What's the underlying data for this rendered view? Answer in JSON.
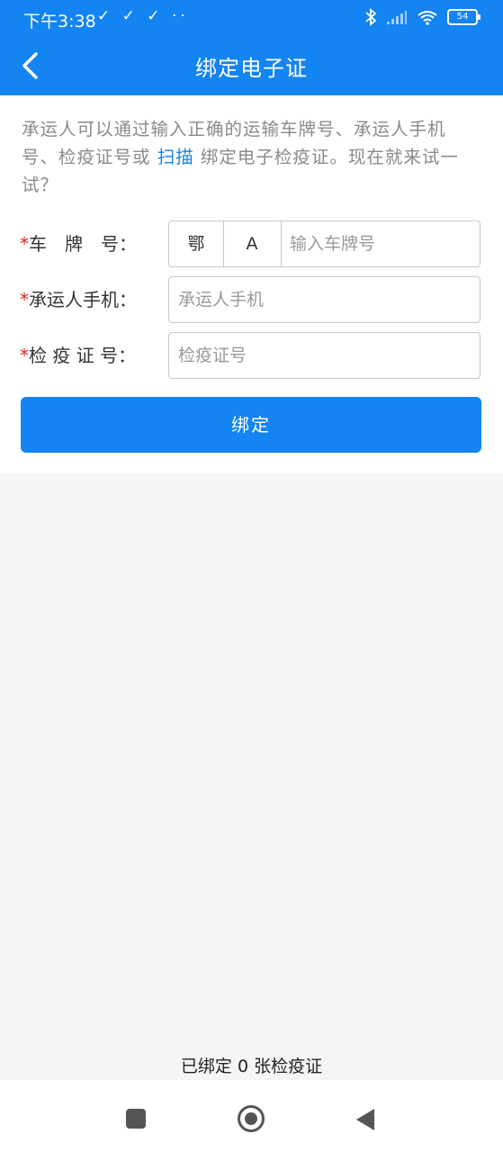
{
  "status_bar": {
    "time": "下午3:38",
    "left_icons": "✓ ✓ ✓ ··",
    "battery": "54"
  },
  "header": {
    "title": "绑定电子证"
  },
  "intro": {
    "text_before_link": "承运人可以通过输入正确的运输车牌号、承运人手机号、检疫证号或 ",
    "link_text": "扫描",
    "text_after_link": " 绑定电子检疫证。现在就来试一试？"
  },
  "form": {
    "plate": {
      "star": "*",
      "label": "车　牌　号：",
      "province": "鄂",
      "letter": "A",
      "placeholder": "输入车牌号"
    },
    "phone": {
      "star": "*",
      "label": "承运人手机：",
      "placeholder": "承运人手机"
    },
    "cert": {
      "star": "*",
      "label": "检 疫 证 号：",
      "placeholder": "检疫证号"
    },
    "bind_button": "绑定"
  },
  "footer": {
    "bound_count": "已绑定 0 张检疫证"
  },
  "colors": {
    "primary": "#1384f2",
    "required": "#e0251b"
  }
}
